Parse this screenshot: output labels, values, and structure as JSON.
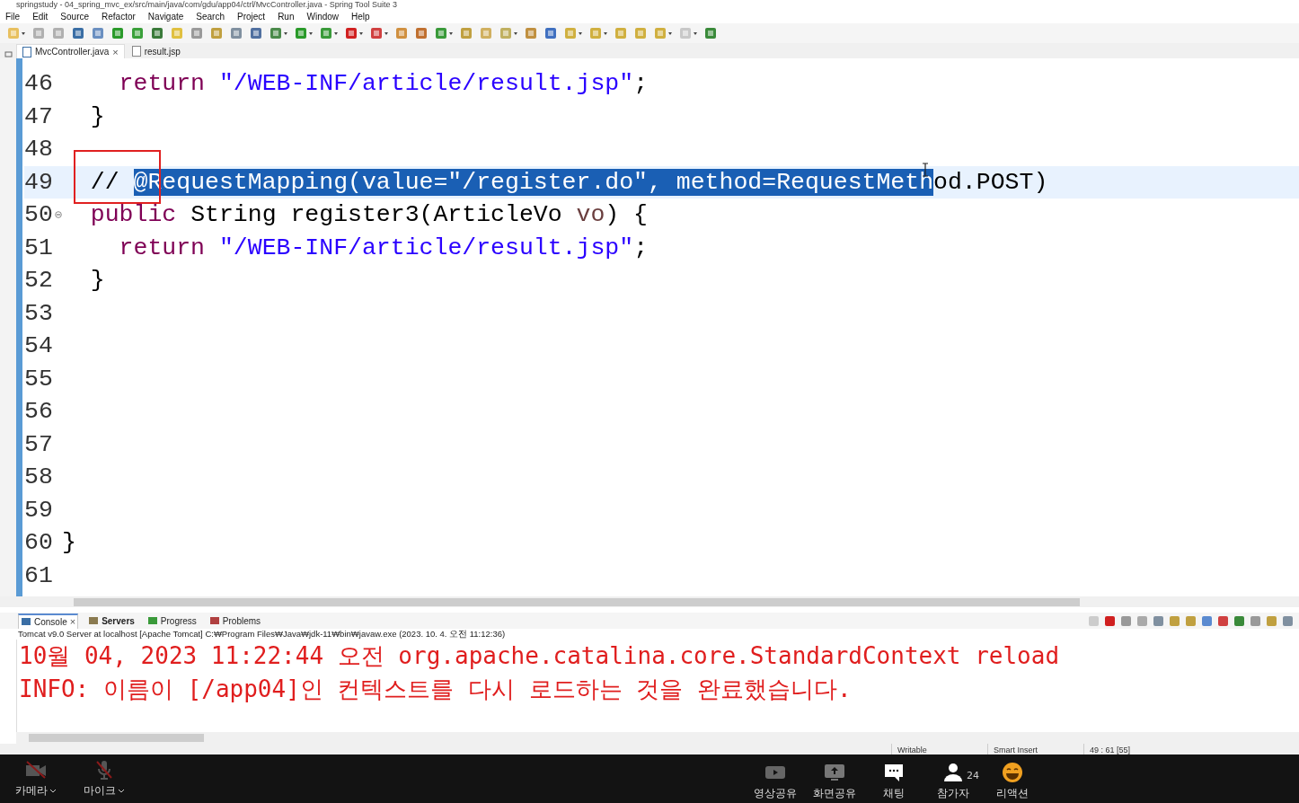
{
  "window": {
    "title": "springstudy - 04_spring_mvc_ex/src/main/java/com/gdu/app04/ctrl/MvcController.java - Spring Tool Suite 3"
  },
  "menu": [
    "File",
    "Edit",
    "Source",
    "Refactor",
    "Navigate",
    "Search",
    "Project",
    "Run",
    "Window",
    "Help"
  ],
  "editor_tabs": [
    {
      "label": "MvcController.java",
      "selected": true,
      "close": "×"
    },
    {
      "label": "result.jsp",
      "selected": false
    }
  ],
  "editor": {
    "lines": [
      {
        "number": "46",
        "current": false,
        "fold": false,
        "segments": [
          {
            "text": "    return ",
            "kind": "keyword"
          },
          {
            "text": "\"/WEB-INF/article/result.jsp\"",
            "kind": "string"
          },
          {
            "text": ";",
            "kind": "plain"
          }
        ]
      },
      {
        "number": "47",
        "current": false,
        "fold": false,
        "segments": [
          {
            "text": "  }",
            "kind": "plain"
          }
        ]
      },
      {
        "number": "48",
        "current": false,
        "fold": false
      },
      {
        "number": "49",
        "current": true,
        "fold": false,
        "segments": [
          {
            "text": "  // ",
            "kind": "plain"
          },
          {
            "text": "@RequestMapping(value=\"/register.do\", method=RequestMeth",
            "kind": "selected"
          },
          {
            "text": "od.POST)",
            "kind": "plain"
          }
        ]
      },
      {
        "number": "50",
        "current": false,
        "fold": true,
        "segments": [
          {
            "text": "  public ",
            "kind": "keyword"
          },
          {
            "text": "String register3(ArticleVo ",
            "kind": "plain"
          },
          {
            "text": "vo",
            "kind": "param"
          },
          {
            "text": ") {",
            "kind": "plain"
          }
        ]
      },
      {
        "number": "51",
        "current": false,
        "fold": false,
        "segments": [
          {
            "text": "    return ",
            "kind": "keyword"
          },
          {
            "text": "\"/WEB-INF/article/result.jsp\"",
            "kind": "string"
          },
          {
            "text": ";",
            "kind": "plain"
          }
        ]
      },
      {
        "number": "52",
        "current": false,
        "fold": false,
        "segments": [
          {
            "text": "  }",
            "kind": "plain"
          }
        ]
      },
      {
        "number": "53",
        "current": false,
        "fold": false
      },
      {
        "number": "54",
        "current": false,
        "fold": false
      },
      {
        "number": "55",
        "current": false,
        "fold": false
      },
      {
        "number": "56",
        "current": false,
        "fold": false
      },
      {
        "number": "57",
        "current": false,
        "fold": false
      },
      {
        "number": "58",
        "current": false,
        "fold": false
      },
      {
        "number": "59",
        "current": false,
        "fold": false
      },
      {
        "number": "60",
        "current": false,
        "fold": false,
        "segments": [
          {
            "text": "}",
            "kind": "top"
          }
        ]
      },
      {
        "number": "61",
        "current": false,
        "fold": false
      }
    ]
  },
  "console": {
    "tabs": [
      {
        "label": "Console",
        "selected": true,
        "emphasized": false,
        "close": "×"
      },
      {
        "label": "Servers",
        "selected": false,
        "emphasized": true
      },
      {
        "label": "Progress",
        "selected": false,
        "emphasized": false
      },
      {
        "label": "Problems",
        "selected": false,
        "emphasized": false
      }
    ],
    "header": "Tomcat v9.0 Server at localhost [Apache Tomcat] C:₩Program Files₩Java₩jdk-11₩bin₩javaw.exe  (2023. 10. 4. 오전 11:12:36)",
    "lines": [
      "10월 04, 2023 11:22:44 오전 org.apache.catalina.core.StandardContext reload",
      "INFO: 이름이 [/app04]인 컨텍스트를 다시 로드하는 것을 완료했습니다."
    ]
  },
  "status_bar": [
    "Writable",
    "Smart Insert",
    "49 : 61 [55]"
  ],
  "meeting_bar": {
    "left": [
      {
        "label": "카메라",
        "kind": "camera"
      },
      {
        "label": "마이크",
        "kind": "mic"
      }
    ],
    "center": [
      {
        "label": "영상공유",
        "kind": "video"
      },
      {
        "label": "화면공유",
        "kind": "screen"
      },
      {
        "label": "채팅",
        "kind": "chat"
      },
      {
        "label": "참가자",
        "kind": "people",
        "count": "24"
      },
      {
        "label": "리액션",
        "kind": "reaction"
      }
    ]
  }
}
